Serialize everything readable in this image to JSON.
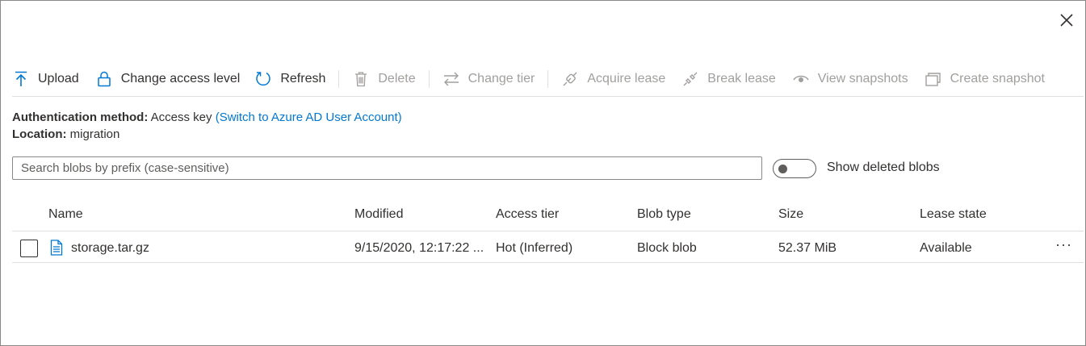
{
  "toolbar": {
    "upload": "Upload",
    "change_access_level": "Change access level",
    "refresh": "Refresh",
    "delete": "Delete",
    "change_tier": "Change tier",
    "acquire_lease": "Acquire lease",
    "break_lease": "Break lease",
    "view_snapshots": "View snapshots",
    "create_snapshot": "Create snapshot"
  },
  "info": {
    "auth_label": "Authentication method:",
    "auth_value": "Access key",
    "auth_link": "(Switch to Azure AD User Account)",
    "location_label": "Location:",
    "location_value": "migration"
  },
  "search": {
    "placeholder": "Search blobs by prefix (case-sensitive)",
    "value": ""
  },
  "toggle": {
    "label": "Show deleted blobs",
    "on": false
  },
  "table": {
    "headers": [
      "Name",
      "Modified",
      "Access tier",
      "Blob type",
      "Size",
      "Lease state"
    ],
    "rows": [
      {
        "name": "storage.tar.gz",
        "modified": "9/15/2020, 12:17:22 ...",
        "access_tier": "Hot (Inferred)",
        "blob_type": "Block blob",
        "size": "52.37 MiB",
        "lease_state": "Available",
        "more": "···"
      }
    ]
  },
  "colors": {
    "accent": "#0078d4",
    "text": "#323130",
    "disabled": "#a19f9d",
    "border": "#8a8886"
  }
}
